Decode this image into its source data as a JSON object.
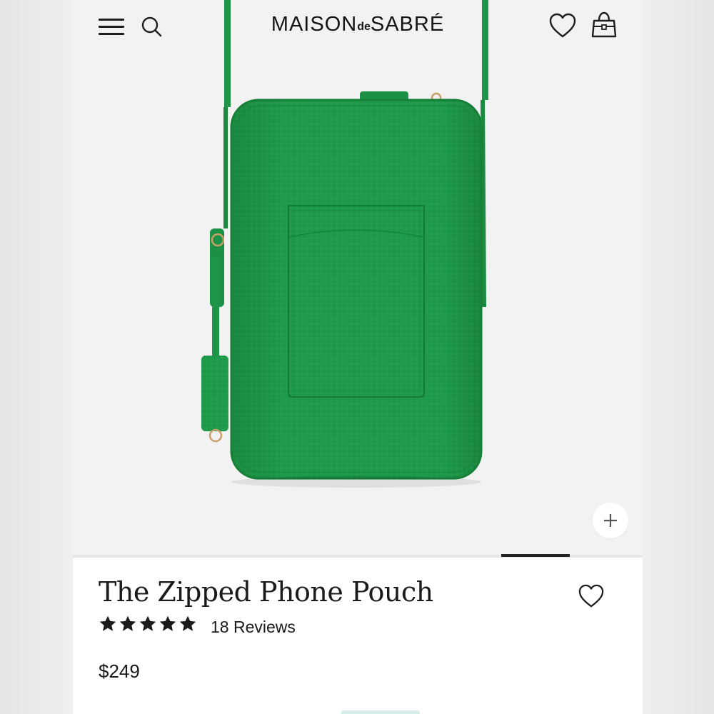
{
  "header": {
    "brand": {
      "pre": "MAISON",
      "mid": "de",
      "post": "SABRÉ"
    },
    "icons": [
      "menu-icon",
      "search-icon",
      "heart-icon",
      "bag-icon"
    ]
  },
  "product": {
    "title": "The Zipped Phone Pouch",
    "rating": 5,
    "reviews_label": "18 Reviews",
    "price": "$249",
    "color": "#1f9a4a"
  },
  "gallery": {
    "zoom_icon": "plus-icon"
  },
  "colors": {
    "accent": "#1f9a4a",
    "text": "#1a1a1a",
    "stars": "#1a1a1a"
  }
}
